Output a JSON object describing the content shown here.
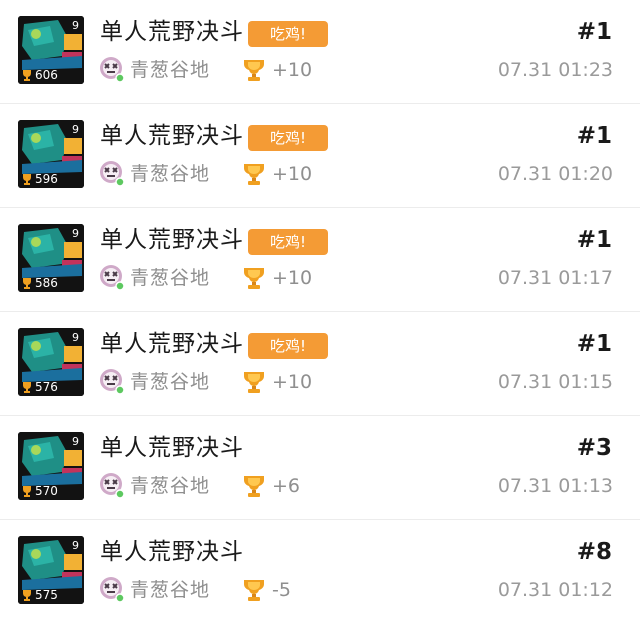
{
  "battle_log": {
    "rows": [
      {
        "mode": "单人荒野决斗",
        "badge": "吃鸡!",
        "rank": "#1",
        "map": "青葱谷地",
        "trophy_change": "+10",
        "time": "07.31 01:23",
        "brawler_trophies": "606",
        "power_level": "9"
      },
      {
        "mode": "单人荒野决斗",
        "badge": "吃鸡!",
        "rank": "#1",
        "map": "青葱谷地",
        "trophy_change": "+10",
        "time": "07.31 01:20",
        "brawler_trophies": "596",
        "power_level": "9"
      },
      {
        "mode": "单人荒野决斗",
        "badge": "吃鸡!",
        "rank": "#1",
        "map": "青葱谷地",
        "trophy_change": "+10",
        "time": "07.31 01:17",
        "brawler_trophies": "586",
        "power_level": "9"
      },
      {
        "mode": "单人荒野决斗",
        "badge": "吃鸡!",
        "rank": "#1",
        "map": "青葱谷地",
        "trophy_change": "+10",
        "time": "07.31 01:15",
        "brawler_trophies": "576",
        "power_level": "9"
      },
      {
        "mode": "单人荒野决斗",
        "badge": "",
        "rank": "#3",
        "map": "青葱谷地",
        "trophy_change": "+6",
        "time": "07.31 01:13",
        "brawler_trophies": "570",
        "power_level": "9"
      },
      {
        "mode": "单人荒野决斗",
        "badge": "",
        "rank": "#8",
        "map": "青葱谷地",
        "trophy_change": "-5",
        "time": "07.31 01:12",
        "brawler_trophies": "575",
        "power_level": "9"
      }
    ]
  },
  "icons": {
    "map": "skull-map-icon",
    "trophy": "trophy-icon",
    "avatar": "brawler-portrait-icon"
  },
  "colors": {
    "badge_bg": "#f49b35",
    "trophy_gold": "#f0a020",
    "map_purple": "#cfa9c8",
    "status_green": "#5dc860",
    "text_dark": "#1a1a1a",
    "text_gray": "#8f8f8f"
  }
}
